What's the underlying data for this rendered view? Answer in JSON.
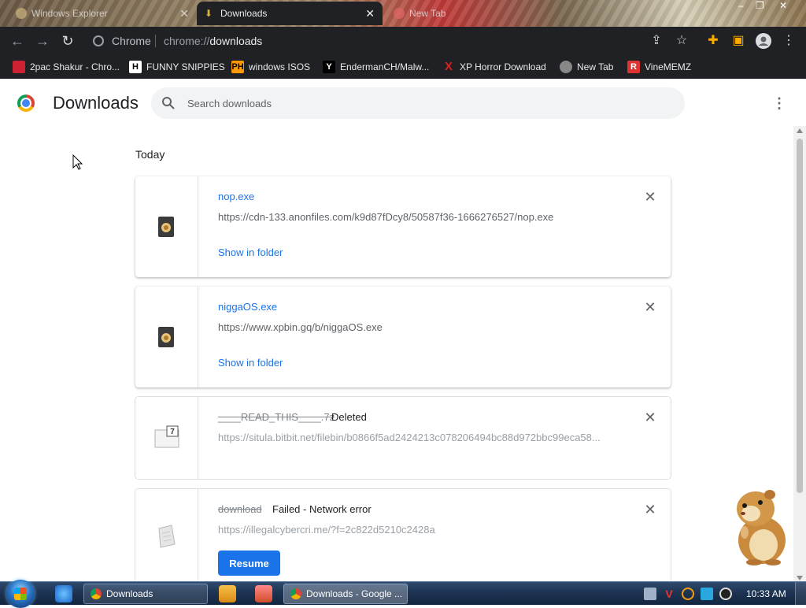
{
  "tabs": [
    {
      "title": "Windows Explorer",
      "active": false
    },
    {
      "title": "Downloads",
      "active": true
    },
    {
      "title": "New Tab",
      "active": false
    }
  ],
  "omnibox": {
    "chip": "Chrome",
    "scheme": "chrome://",
    "host": "downloads"
  },
  "bookmarks": [
    {
      "label": "2pac Shakur - Chro...",
      "icon": "bookmark-favicon"
    },
    {
      "label": "FUNNY SNIPPIES",
      "icon": "H"
    },
    {
      "label": "windows ISOS",
      "icon": "PH"
    },
    {
      "label": "EndermanCH/Malw...",
      "icon": "YP"
    },
    {
      "label": "XP Horror Download",
      "icon": "X"
    },
    {
      "label": "New Tab",
      "icon": "globe"
    },
    {
      "label": "VineMEMZ",
      "icon": "R"
    }
  ],
  "page": {
    "title": "Downloads",
    "search_placeholder": "Search downloads",
    "section": "Today"
  },
  "downloads": [
    {
      "name": "nop.exe",
      "url": "https://cdn-133.anonfiles.com/k9d87fDcy8/50587f36-1666276527/nop.exe",
      "action": "Show in folder",
      "state": "",
      "icon": "exe-file-icon"
    },
    {
      "name": "niggaOS.exe",
      "url": "https://www.xpbin.gq/b/niggaOS.exe",
      "action": "Show in folder",
      "state": "",
      "icon": "exe-file-icon"
    },
    {
      "name": "____READ_THIS____.7z",
      "url": "https://situla.bitbit.net/filebin/b0866f5ad2424213c078206494bc88d972bbc99eca58...",
      "action": "",
      "state": "Deleted",
      "icon": "7z-file-icon"
    },
    {
      "name": "download",
      "url": "https://illegalcybercri.me/?f=2c822d5210c2428a",
      "action": "Resume",
      "state": "Failed - Network error",
      "icon": "generic-file-icon"
    }
  ],
  "taskbar": {
    "tasks": [
      "Downloads",
      "Downloads - Google ..."
    ],
    "clock": "10:33 AM"
  },
  "colors": {
    "link": "#1a73e8",
    "dark_chrome": "#202124",
    "taskbar": "#1c3250"
  }
}
